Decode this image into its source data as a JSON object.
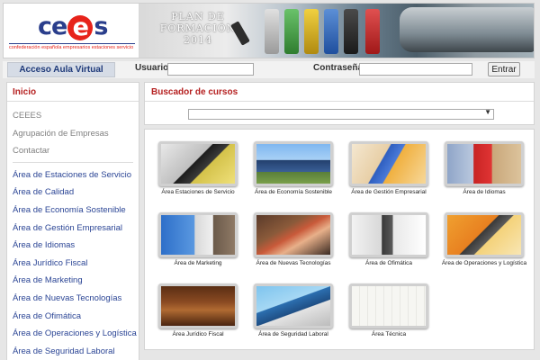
{
  "header": {
    "logo_prefix": "ce",
    "logo_e": "e",
    "logo_suffix": "s",
    "logo_subtitle": "confederación española empresarios estaciones servicio",
    "plan_line1": "PLAN DE",
    "plan_line2": "FORMACIÓN",
    "plan_line3": "2014"
  },
  "login": {
    "aula_label": "Acceso Aula Virtual",
    "user_label": "Usuario",
    "user_value": "",
    "password_label": "Contraseña",
    "password_value": "",
    "submit_label": "Entrar"
  },
  "sidebar": {
    "heading": "Inicio",
    "top_items": [
      {
        "label": "CEEES"
      },
      {
        "label": "Agrupación de Empresas"
      },
      {
        "label": "Contactar"
      }
    ],
    "area_items": [
      {
        "label": "Área de Estaciones de Servicio"
      },
      {
        "label": "Área de Calidad"
      },
      {
        "label": "Área de Economía Sostenible"
      },
      {
        "label": "Área de Gestión Empresarial"
      },
      {
        "label": "Área de Idiomas"
      },
      {
        "label": "Área Jurídico Fiscal"
      },
      {
        "label": "Área de Marketing"
      },
      {
        "label": "Área de Nuevas Tecnologías"
      },
      {
        "label": "Área de Ofimática"
      },
      {
        "label": "Área de Operaciones y Logística"
      },
      {
        "label": "Área de Seguridad Laboral"
      }
    ]
  },
  "search": {
    "heading": "Buscador de cursos",
    "selected_value": ""
  },
  "courses": [
    {
      "label": "Área Estaciones de Servicio"
    },
    {
      "label": "Área de Economía Sostenible"
    },
    {
      "label": "Área de Gestión Empresarial"
    },
    {
      "label": "Área de Idiomas"
    },
    {
      "label": "Área de Marketing"
    },
    {
      "label": "Área de Nuevas Tecnologías"
    },
    {
      "label": "Área de Ofimática"
    },
    {
      "label": "Área de Operaciones y Logística"
    },
    {
      "label": "Área Jurídico Fiscal"
    },
    {
      "label": "Área de Seguridad Laboral"
    },
    {
      "label": "Área Técnica"
    }
  ],
  "colors": {
    "brand_blue": "#2a3e8c",
    "brand_red": "#e7231a",
    "heading_red": "#b52020",
    "link_blue": "#2b4595"
  }
}
